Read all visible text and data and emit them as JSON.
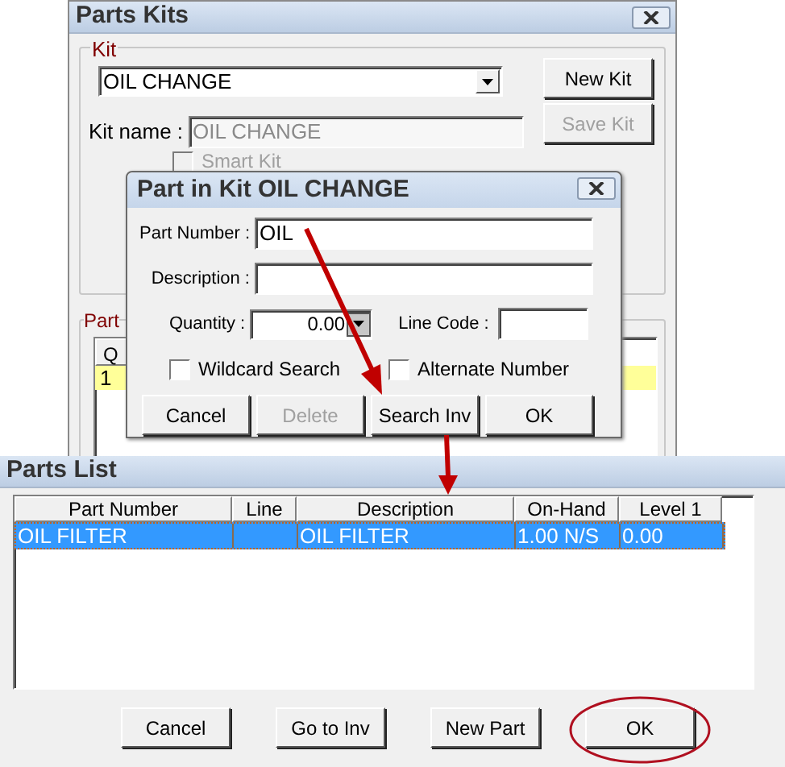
{
  "parts_kits": {
    "title": "Parts Kits",
    "kit_group": {
      "label": "Kit",
      "kit_select": "OIL CHANGE",
      "kit_name_label": "Kit name :",
      "kit_name": "OIL CHANGE",
      "kit_name_disabled": true,
      "smart_kit": {
        "label": "Smart Kit",
        "checked": false,
        "disabled": true
      }
    },
    "buttons": [
      {
        "label": "New Kit",
        "disabled": false
      },
      {
        "label": "Save Kit",
        "disabled": true
      }
    ],
    "parts_group": {
      "label": "Part",
      "columns": [
        "Q"
      ],
      "rows": [
        {
          "cells": [
            "1"
          ],
          "selected": true
        }
      ]
    }
  },
  "part_dialog": {
    "title": "Part in Kit OIL CHANGE",
    "part_number_label": "Part Number :",
    "part_number": "OIL",
    "description_label": "Description :",
    "quantity_label": "Quantity :",
    "quantity": "0.00",
    "line_code_label": "Line Code :",
    "checkboxes": [
      {
        "label": "Wildcard Search",
        "checked": false
      },
      {
        "label": "Alternate Number",
        "checked": false
      }
    ],
    "buttons": [
      {
        "label": "Cancel",
        "disabled": false
      },
      {
        "label": "Delete",
        "disabled": true
      },
      {
        "label": "Search Inv",
        "disabled": false
      },
      {
        "label": "OK",
        "disabled": false
      }
    ]
  },
  "parts_list": {
    "title": "Parts List",
    "columns": [
      "Part Number",
      "Line",
      "Description",
      "On-Hand",
      "Level 1"
    ],
    "rows": [
      {
        "cells": [
          "OIL FILTER",
          "",
          "OIL FILTER",
          "1.00 N/S",
          "0.00"
        ],
        "selected": true
      }
    ],
    "buttons": [
      {
        "label": "Cancel",
        "circled": false
      },
      {
        "label": "Go to Inv",
        "circled": false
      },
      {
        "label": "New Part",
        "circled": false
      },
      {
        "label": "OK",
        "circled": true
      }
    ]
  }
}
